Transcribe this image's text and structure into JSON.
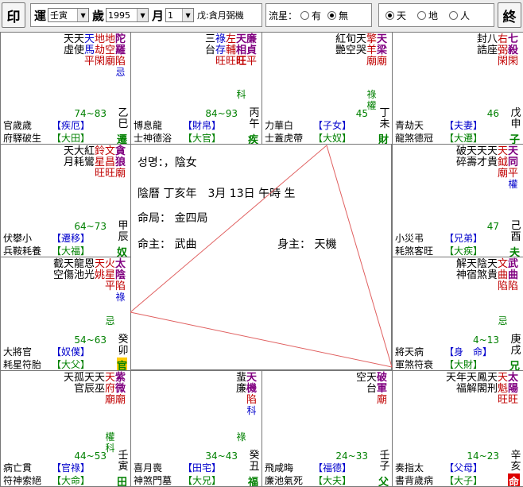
{
  "toolbar": {
    "print_label": "印",
    "run_label": "運",
    "year_label": "歲",
    "month_label": "月",
    "run_select": "壬寅",
    "year_select": "1995",
    "month_select": "1",
    "info_text": "戊:貪月弼機",
    "flow_label": "流星：",
    "flow_opt_yes": "有",
    "flow_opt_no": "無",
    "opt_tian": "天",
    "opt_di": "地",
    "opt_ren": "人",
    "end_label": "終"
  },
  "center": {
    "line1": "성명：，陰女",
    "line2": "陰曆 丁亥年　3月 13日 午時 生",
    "line3": "命局： 金四局",
    "line4a": "命主： 武曲",
    "line4b": "身主： 天機"
  },
  "palaces": [
    {
      "cols": [
        [
          "陀",
          "羅",
          "陷",
          "忌"
        ],
        [
          "地",
          "空",
          "廟"
        ],
        [
          "地",
          "劫",
          "閑"
        ],
        [
          "天",
          "馬",
          "平"
        ],
        [
          "天",
          "使"
        ],
        [
          "天",
          "虛"
        ]
      ],
      "colors": [
        "pur",
        "red",
        "red",
        "blu",
        "blk",
        "blk"
      ],
      "range": "74~83",
      "gz": [
        "乙",
        "巳"
      ],
      "role": "【疾厄】",
      "role2": "【大田】",
      "bot1": "官歲歲",
      "bot2": "府驛破生",
      "gzb": "遷"
    },
    {
      "cols": [
        [
          "廉",
          "貞",
          "平"
        ],
        [
          "天",
          "相",
          "旺"
        ],
        [
          "左",
          "輔",
          "旺"
        ],
        [
          "祿",
          "存",
          "旺"
        ],
        [
          "三",
          "台"
        ]
      ],
      "colors": [
        "pur",
        "pur",
        "red",
        "blu",
        "blk"
      ],
      "extra": "科",
      "range": "84~93",
      "gz": [
        "丙",
        "午"
      ],
      "role": "【財帛】",
      "role2": "【大官】",
      "bot1": "博息龍",
      "bot2": "士神德浴",
      "gzb": "疾"
    },
    {
      "cols": [
        [
          "天",
          "梁",
          "廟"
        ],
        [
          "擎",
          "羊",
          "廟"
        ],
        [
          "天",
          "哭"
        ],
        [
          "旬",
          "空"
        ],
        [
          "紅",
          "艷"
        ]
      ],
      "colors": [
        "pur",
        "red",
        "blk",
        "blk",
        "blk"
      ],
      "extra": "祿權",
      "range": "45",
      "gz": [
        "丁",
        "未"
      ],
      "role": "【子女】",
      "role2": "【大奴】",
      "bot1": "力華白",
      "bot2": "士蓋虎帶",
      "gzb": "財"
    },
    {
      "cols": [
        [
          "七",
          "殺",
          "閑"
        ],
        [
          "右",
          "弼",
          "閑"
        ],
        [
          "八",
          "座"
        ],
        [
          "封",
          "誥"
        ]
      ],
      "colors": [
        "pur",
        "red",
        "blk",
        "blk"
      ],
      "range": "46",
      "gz": [
        "戊",
        "申"
      ],
      "role": "【夫妻】",
      "role2": "【大遷】",
      "bot1": "青劫天",
      "bot2": "龍煞德冠",
      "gzb": "子"
    },
    {
      "cols": [
        [
          "貪",
          "狼",
          "廟"
        ],
        [
          "文",
          "昌",
          "旺"
        ],
        [
          "鈴",
          "星",
          "旺"
        ],
        [
          "紅",
          "鸞"
        ],
        [
          "大",
          "耗"
        ],
        [
          "天",
          "月"
        ]
      ],
      "colors": [
        "pur",
        "red",
        "red",
        "blk",
        "blk",
        "blk"
      ],
      "range": "64~73",
      "gz": [
        "甲",
        "辰"
      ],
      "role": "【遷移】",
      "role2": "【大福】",
      "bot1": "伏攀小",
      "bot2": "兵鞍耗養",
      "gzb": "奴"
    },
    {
      "cols": [
        [
          "天",
          "同",
          "平",
          "權"
        ],
        [
          "天",
          "鉞",
          "廟"
        ],
        [
          "天",
          "貴"
        ],
        [
          "天",
          "才"
        ],
        [
          "天",
          "壽"
        ],
        [
          "破",
          "碎"
        ]
      ],
      "colors": [
        "pur",
        "red",
        "blk",
        "blk",
        "blk",
        "blk"
      ],
      "range": "47",
      "gz": [
        "己",
        "酉"
      ],
      "role": "【兄弟】",
      "role2": "【大疾】",
      "bot1": "小災弔",
      "bot2": "耗煞客旺",
      "gzb": "夫"
    },
    {
      "cols": [
        [
          "太",
          "陰",
          "陷",
          "祿"
        ],
        [
          "火",
          "星",
          "平"
        ],
        [
          "天",
          "姚"
        ],
        [
          "恩",
          "光"
        ],
        [
          "龍",
          "池"
        ],
        [
          "天",
          "傷"
        ],
        [
          "截",
          "空"
        ]
      ],
      "colors": [
        "pur",
        "red",
        "red",
        "blk",
        "blk",
        "blk",
        "blk"
      ],
      "extra": "忌",
      "range": "54~63",
      "gz": [
        "癸",
        "卯"
      ],
      "gz2": "53",
      "role": "【奴僕】",
      "role2": "【大父】",
      "bot1": "大將官",
      "bot2": "耗星符胎",
      "gzb": "官"
    },
    {
      "cols": [
        [
          "武",
          "曲",
          "陷"
        ],
        [
          "文",
          "曲",
          "陷"
        ],
        [
          "天",
          "貴"
        ],
        [
          "陰",
          "煞"
        ],
        [
          "天",
          "宿"
        ],
        [
          "解",
          "神"
        ]
      ],
      "colors": [
        "pur",
        "red",
        "blk",
        "blk",
        "blk",
        "blk"
      ],
      "extra": "忌",
      "range": "4~13",
      "gz": [
        "庚",
        "戌"
      ],
      "gz2": "48",
      "role": "【身　命】",
      "role2": "【大財】",
      "bot1": "將天病",
      "bot2": "軍煞符衰",
      "gzb": "兄"
    },
    {
      "cols": [
        [
          "紫",
          "微",
          "廟"
        ],
        [
          "天",
          "府",
          "廟"
        ],
        [
          "天",
          "巫"
        ],
        [
          "天",
          "辰"
        ],
        [
          "孤",
          "官"
        ],
        [
          "天"
        ]
      ],
      "colors": [
        "pur",
        "red",
        "blk",
        "blk",
        "blk",
        "blk"
      ],
      "extra": "權科",
      "range": "44~53",
      "gz": [
        "壬",
        "寅"
      ],
      "gz2": "52",
      "role": "【官祿】",
      "role2": "【大命】",
      "bot1": "病亡貫",
      "bot2": "符神索絕",
      "gzb": "田"
    },
    {
      "cols": [
        [
          "天",
          "機",
          "陷",
          "科"
        ],
        [
          "蜚",
          "廉"
        ]
      ],
      "colors": [
        "pur",
        "blk"
      ],
      "extra": "祿",
      "range": "34~43",
      "gz": [
        "癸",
        "丑"
      ],
      "gz2": "51",
      "role": "【田宅】",
      "role2": "【大兄】",
      "bot1": "喜月喪",
      "bot2": "神煞門墓",
      "gzb": "福"
    },
    {
      "cols": [
        [
          "破",
          "軍",
          "廟"
        ],
        [
          "天",
          "台"
        ],
        [
          "空"
        ]
      ],
      "colors": [
        "pur",
        "blk",
        "blk"
      ],
      "range": "24~33",
      "gz": [
        "壬",
        "子"
      ],
      "gz2": "50",
      "role": "【福德】",
      "role2": "【大夫】",
      "bot1": "飛咸晦",
      "bot2": "廉池氣死",
      "gzb": "父"
    },
    {
      "cols": [
        [
          "太",
          "陽",
          "旺"
        ],
        [
          "天",
          "魁",
          "旺"
        ],
        [
          "天",
          "刑"
        ],
        [
          "鳳",
          "閣"
        ],
        [
          "天",
          "解"
        ],
        [
          "年",
          "福"
        ],
        [
          "天"
        ]
      ],
      "colors": [
        "pur",
        "red",
        "blk",
        "blk",
        "blk",
        "blk",
        "blk"
      ],
      "range": "14~23",
      "gz": [
        "辛",
        "亥"
      ],
      "gz2": "49",
      "role": "【父母】",
      "role2": "【大子】",
      "bot1": "奏指太",
      "bot2": "書背歲病",
      "gzb": "命"
    }
  ]
}
